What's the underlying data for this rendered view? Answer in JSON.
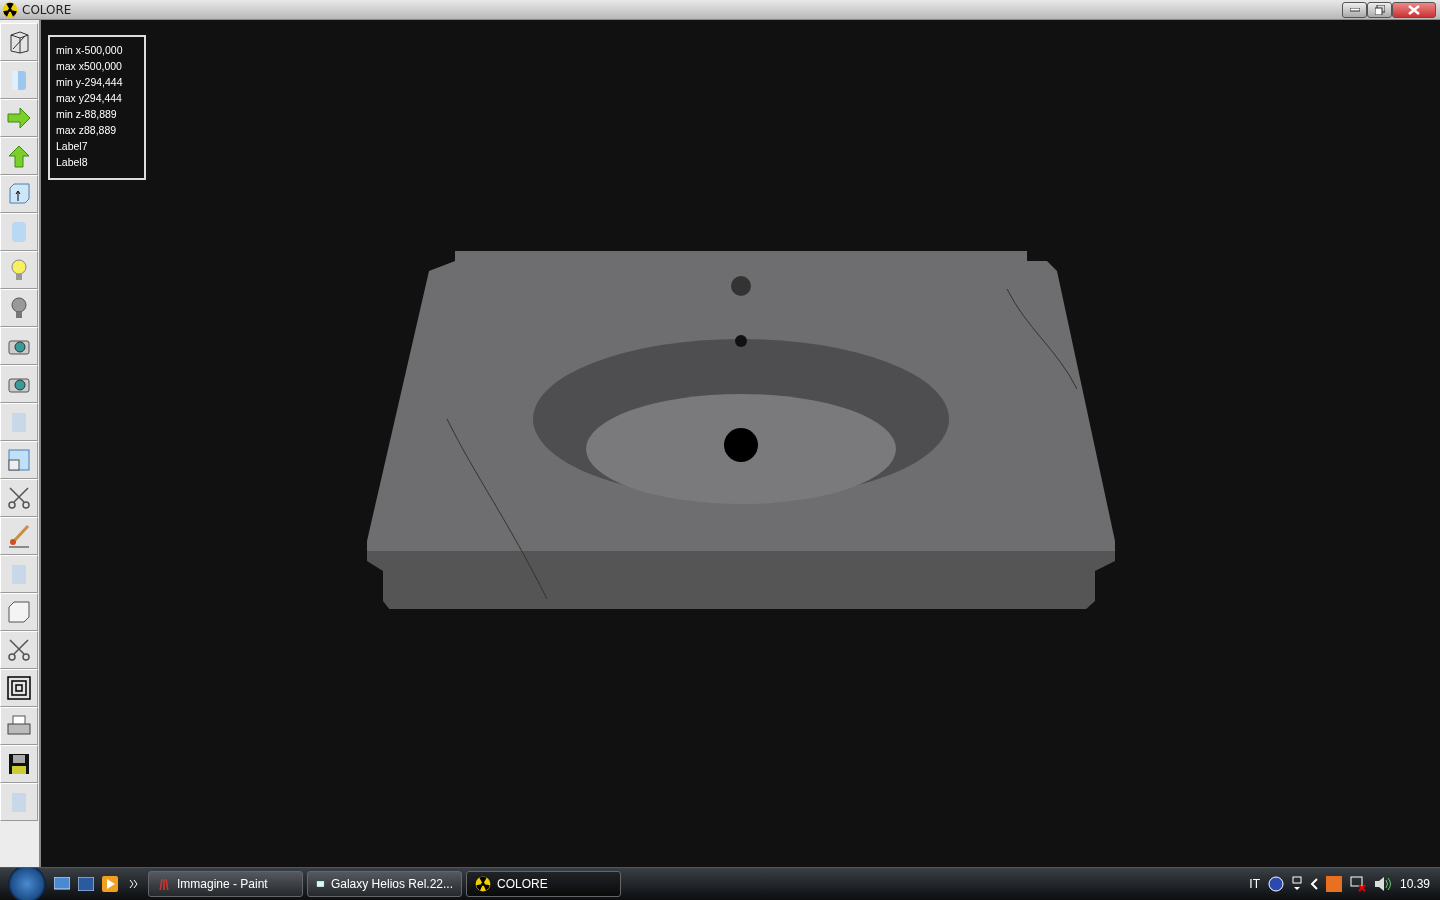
{
  "window": {
    "title": "COLORE"
  },
  "info_box": {
    "lines": [
      "min x-500,000",
      "max x500,000",
      "min y-294,444",
      "max y294,444",
      "min z-88,889",
      "max z88,889",
      "Label7",
      "Label8"
    ]
  },
  "taskbar": {
    "tasks": [
      {
        "label": "Immagine - Paint",
        "selected": false
      },
      {
        "label": "Galaxy Helios  Rel.22...",
        "selected": false
      },
      {
        "label": "COLORE",
        "selected": true
      }
    ],
    "language": "IT",
    "clock": "10.39"
  }
}
